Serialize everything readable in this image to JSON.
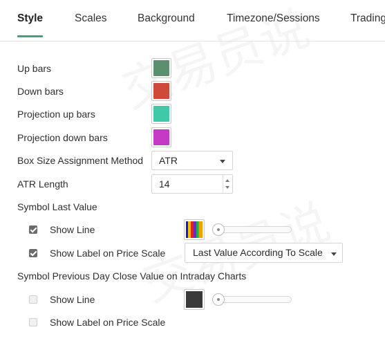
{
  "tabs": [
    {
      "label": "Style",
      "active": true
    },
    {
      "label": "Scales"
    },
    {
      "label": "Background"
    },
    {
      "label": "Timezone/Sessions"
    },
    {
      "label": "Trading"
    }
  ],
  "colors": {
    "accent": "#43a27b",
    "up_bars": "#5b8f6e",
    "down_bars": "#cf4a3b",
    "projection_up": "#3fc9a6",
    "projection_down": "#c43ac4",
    "prev_close_line": "#3a3a3a"
  },
  "style": {
    "up_bars_label": "Up bars",
    "down_bars_label": "Down bars",
    "projection_up_label": "Projection up bars",
    "projection_down_label": "Projection down bars",
    "box_size": {
      "label": "Box Size Assignment Method",
      "value": "ATR"
    },
    "atr_length": {
      "label": "ATR Length",
      "value": "14"
    },
    "symbol_last_value": {
      "heading": "Symbol Last Value",
      "show_line": {
        "label": "Show Line",
        "checked": true
      },
      "show_label": {
        "label": "Show Label on Price Scale",
        "checked": true
      },
      "scale_mode": "Last Value According To Scale"
    },
    "prev_close": {
      "heading": "Symbol Previous Day Close Value on Intraday Charts",
      "show_line": {
        "label": "Show Line",
        "checked": false
      },
      "show_label": {
        "label": "Show Label on Price Scale",
        "checked": false
      }
    }
  }
}
